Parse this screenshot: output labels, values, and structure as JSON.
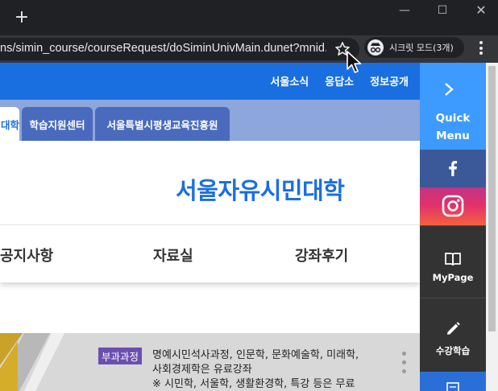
{
  "browser": {
    "new_tab_label": "+",
    "window_controls": {
      "minimize": "—",
      "maximize": "☐",
      "close": "✕"
    },
    "url": "ns/simin_course/courseRequest/doSiminUnivMain.dunet?mnid...",
    "incognito_label": "시크릿 모드(3개)",
    "icons": [
      "new-tab-icon",
      "star-icon",
      "incognito-icon",
      "more-icon",
      "mouse-cursor-icon"
    ]
  },
  "header": {
    "top_links": [
      "서울소식",
      "응답소",
      "정보공개"
    ],
    "tabs": [
      {
        "label": "대학",
        "active": true
      },
      {
        "label": "학습지원센터",
        "active": false
      },
      {
        "label": "서울특별시평생교육진흥원",
        "active": false
      }
    ],
    "brand": "서울자유시민대학"
  },
  "menu": {
    "items": [
      "공지사항",
      "자료실",
      "강좌후기"
    ]
  },
  "banner": {
    "tag": "부과과정",
    "lines": [
      "명예시민석사과정, 인문학, 문화예술학, 미래학,",
      "사회경제학은 유료강좌",
      "※ 시민학, 서울학, 생활환경학, 특강 등은 무료"
    ]
  },
  "quick_menu": {
    "title_lines": [
      "Quick",
      "Menu"
    ],
    "items": [
      {
        "label": "MyPage",
        "icon": "book-icon"
      },
      {
        "label": "수강학습",
        "icon": "pencil-icon"
      }
    ]
  },
  "colors": {
    "primary": "#1a6fe0",
    "quick_head": "#3d9aff",
    "tab_bg": "#8da6dc",
    "tag": "#6a4fb0"
  }
}
